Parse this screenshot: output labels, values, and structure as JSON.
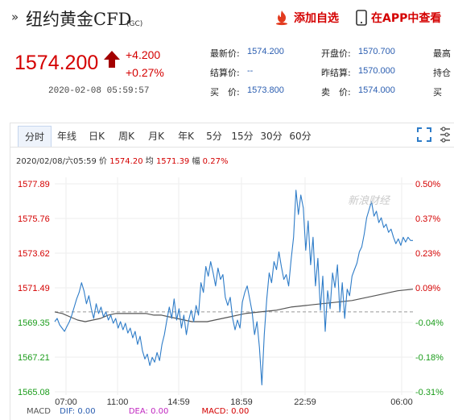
{
  "header": {
    "nav_arrow": "»",
    "title": "纽约黄金CFD",
    "code": "(GC)",
    "add_favorite": "添加自选",
    "open_app": "在APP中查看"
  },
  "quote": {
    "price": "1574.200",
    "change": "+4.200",
    "change_pct": "+0.27%",
    "timestamp": "2020-02-08 05:59:57",
    "stats": [
      {
        "label": "最新价:",
        "value": "1574.200"
      },
      {
        "label": "开盘价:",
        "value": "1570.700"
      },
      {
        "label": "最高",
        "value": ""
      },
      {
        "label": "结算价:",
        "value": "--"
      },
      {
        "label": "昨结算:",
        "value": "1570.000"
      },
      {
        "label": "持仓",
        "value": ""
      },
      {
        "label": "买　价:",
        "value": "1573.800"
      },
      {
        "label": "卖　价:",
        "value": "1574.000"
      },
      {
        "label": "买",
        "value": ""
      }
    ]
  },
  "tabs": [
    "分时",
    "年线",
    "日K",
    "周K",
    "月K",
    "年K",
    "5分",
    "15分",
    "30分",
    "60分"
  ],
  "active_tab": "分时",
  "chart_info": {
    "datetime": "2020/02/08/六05:59",
    "price_label": "价",
    "price": "1574.20",
    "avg_label": "均",
    "avg": "1571.39",
    "amp_label": "幅",
    "amp": "0.27%"
  },
  "watermark": "新浪财经",
  "colors": {
    "up": "#d40000",
    "down": "#1a9c1a",
    "line": "#2e7cc8",
    "avg": "#555555",
    "link": "#2a5db0"
  },
  "macd": {
    "label": "MACD",
    "dif_label": "DIF:",
    "dif": "0.00",
    "dea_label": "DEA:",
    "dea": "0.00",
    "macd_label": "MACD:",
    "macd": "0.00"
  },
  "chart_data": {
    "type": "line",
    "y_left_ticks": [
      "1577.89",
      "1575.76",
      "1573.62",
      "1571.49",
      "1569.35",
      "1567.21",
      "1565.08"
    ],
    "y_right_ticks": [
      "0.50%",
      "0.37%",
      "0.23%",
      "0.09%",
      "-0.04%",
      "-0.18%",
      "-0.31%"
    ],
    "x_ticks": [
      "07:00",
      "11:00",
      "14:59",
      "18:59",
      "22:59",
      "06:00"
    ],
    "ylim": [
      1565.08,
      1577.89
    ],
    "reference": 1570.0,
    "series": [
      {
        "values": [
          1569.4,
          1569.6,
          1569.2,
          1569.0,
          1568.8,
          1569.1,
          1569.4,
          1569.8,
          1570.3,
          1570.8,
          1571.2,
          1571.8,
          1571.3,
          1570.5,
          1571.0,
          1570.2,
          1569.6,
          1570.5,
          1569.9,
          1570.3,
          1569.7,
          1570.0,
          1569.5,
          1569.8,
          1569.3,
          1569.6,
          1569.0,
          1569.4,
          1568.9,
          1569.3,
          1568.7,
          1569.0,
          1568.4,
          1568.8,
          1568.0,
          1568.5,
          1567.6,
          1567.1,
          1567.4,
          1566.7,
          1567.2,
          1566.9,
          1567.5,
          1567.0,
          1568.0,
          1568.6,
          1569.5,
          1570.3,
          1569.6,
          1570.8,
          1569.5,
          1570.2,
          1569.0,
          1569.8,
          1568.6,
          1569.5,
          1570.1,
          1569.4,
          1570.4,
          1569.8,
          1571.8,
          1571.2,
          1572.8,
          1572.2,
          1573.1,
          1572.4,
          1571.6,
          1572.7,
          1572.0,
          1572.3,
          1570.9,
          1570.4,
          1570.9,
          1569.6,
          1568.9,
          1569.5,
          1569.0,
          1570.6,
          1571.2,
          1571.6,
          1570.8,
          1570.0,
          1568.6,
          1569.4,
          1567.8,
          1565.5,
          1568.6,
          1570.8,
          1572.4,
          1571.8,
          1573.1,
          1572.6,
          1573.7,
          1572.8,
          1572.0,
          1572.3,
          1571.6,
          1573.2,
          1574.6,
          1577.5,
          1576.0,
          1577.2,
          1576.4,
          1573.8,
          1575.6,
          1572.9,
          1574.6,
          1571.6,
          1573.3,
          1570.1,
          1572.2,
          1568.8,
          1571.3,
          1570.2,
          1572.4,
          1571.5,
          1572.9,
          1570.0,
          1571.8,
          1569.6,
          1571.4,
          1571.0,
          1572.2,
          1572.6,
          1573.0,
          1573.7,
          1574.0,
          1574.8,
          1575.8,
          1576.3,
          1576.8,
          1575.9,
          1576.2,
          1575.5,
          1575.8,
          1575.2,
          1575.4,
          1574.9,
          1575.1,
          1574.6,
          1574.2,
          1574.5,
          1574.1,
          1574.6,
          1574.3,
          1574.6,
          1574.4,
          1574.4
        ]
      },
      {
        "values": [
          1570.0,
          1569.9,
          1569.7,
          1569.5,
          1569.4,
          1569.5,
          1569.6,
          1569.8,
          1569.9,
          1569.9,
          1569.9,
          1569.9,
          1569.9,
          1569.8,
          1569.8,
          1569.7,
          1569.6,
          1569.5,
          1569.4,
          1569.4,
          1569.4,
          1569.5,
          1569.6,
          1569.7,
          1569.8,
          1569.9,
          1569.95,
          1570.0,
          1570.05,
          1570.1,
          1570.2,
          1570.3,
          1570.35,
          1570.4,
          1570.45,
          1570.5,
          1570.55,
          1570.6,
          1570.65,
          1570.7,
          1570.8,
          1570.9,
          1571.0,
          1571.1,
          1571.2,
          1571.3,
          1571.35,
          1571.4
        ]
      }
    ]
  }
}
